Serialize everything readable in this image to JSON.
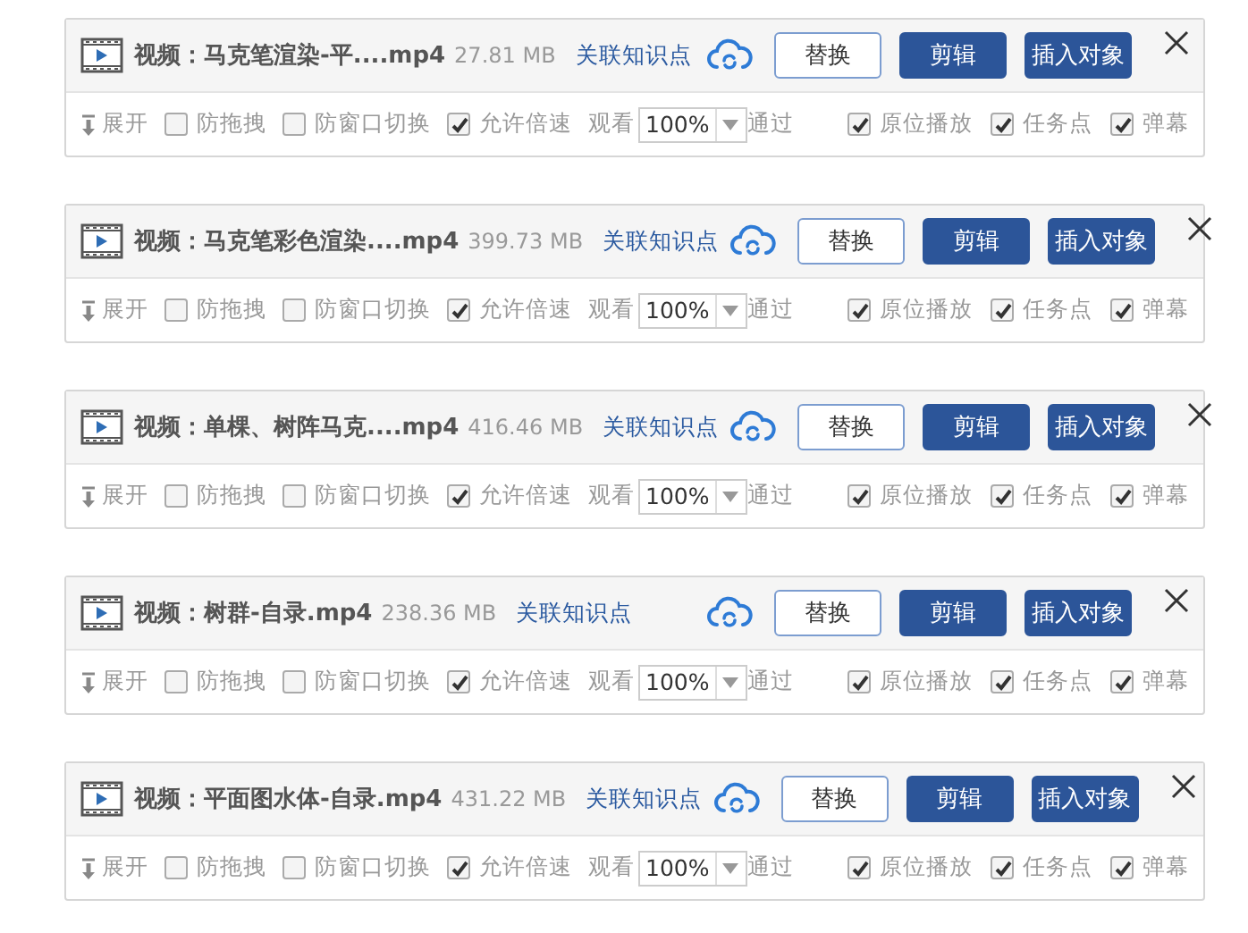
{
  "cards": [
    {
      "title": "视频：马克笔渲染-平....mp4",
      "size": "27.81 MB",
      "link": "关联知识点",
      "buttons": [
        {
          "label": "替换",
          "kind": "outline"
        },
        {
          "label": "剪辑",
          "kind": "primary"
        },
        {
          "label": "插入对象",
          "kind": "primary"
        }
      ],
      "expand": "展开",
      "options": [
        {
          "label": "防拖拽",
          "checked": false
        },
        {
          "label": "防窗口切换",
          "checked": false
        },
        {
          "label": "允许倍速",
          "checked": true
        }
      ],
      "watch_label": "观看",
      "speed": "100%",
      "pass_label": "通过",
      "right_options": [
        {
          "label": "原位播放",
          "checked": true
        },
        {
          "label": "任务点",
          "checked": true
        },
        {
          "label": "弹幕",
          "checked": true
        }
      ]
    },
    {
      "title": "视频：马克笔彩色渲染....mp4",
      "size": "399.73 MB",
      "link": "关联知识点",
      "buttons": [
        {
          "label": "替换",
          "kind": "outline"
        },
        {
          "label": "剪辑",
          "kind": "primary"
        },
        {
          "label": "插入对象",
          "kind": "primary"
        }
      ],
      "expand": "展开",
      "options": [
        {
          "label": "防拖拽",
          "checked": false
        },
        {
          "label": "防窗口切换",
          "checked": false
        },
        {
          "label": "允许倍速",
          "checked": true
        }
      ],
      "watch_label": "观看",
      "speed": "100%",
      "pass_label": "通过",
      "right_options": [
        {
          "label": "原位播放",
          "checked": true
        },
        {
          "label": "任务点",
          "checked": true
        },
        {
          "label": "弹幕",
          "checked": true
        }
      ]
    },
    {
      "title": "视频：单棵、树阵马克....mp4",
      "size": "416.46 MB",
      "link": "关联知识点",
      "buttons": [
        {
          "label": "替换",
          "kind": "outline"
        },
        {
          "label": "剪辑",
          "kind": "primary"
        },
        {
          "label": "插入对象",
          "kind": "primary"
        }
      ],
      "expand": "展开",
      "options": [
        {
          "label": "防拖拽",
          "checked": false
        },
        {
          "label": "防窗口切换",
          "checked": false
        },
        {
          "label": "允许倍速",
          "checked": true
        }
      ],
      "watch_label": "观看",
      "speed": "100%",
      "pass_label": "通过",
      "right_options": [
        {
          "label": "原位播放",
          "checked": true
        },
        {
          "label": "任务点",
          "checked": true
        },
        {
          "label": "弹幕",
          "checked": true
        }
      ]
    },
    {
      "title": "视频：树群-自录.mp4",
      "size": "238.36 MB",
      "link": "关联知识点",
      "buttons": [
        {
          "label": "替换",
          "kind": "outline"
        },
        {
          "label": "剪辑",
          "kind": "primary"
        },
        {
          "label": "插入对象",
          "kind": "primary"
        }
      ],
      "expand": "展开",
      "options": [
        {
          "label": "防拖拽",
          "checked": false
        },
        {
          "label": "防窗口切换",
          "checked": false
        },
        {
          "label": "允许倍速",
          "checked": true
        }
      ],
      "watch_label": "观看",
      "speed": "100%",
      "pass_label": "通过",
      "right_options": [
        {
          "label": "原位播放",
          "checked": true
        },
        {
          "label": "任务点",
          "checked": true
        },
        {
          "label": "弹幕",
          "checked": true
        }
      ]
    },
    {
      "title": "视频：平面图水体-自录.mp4",
      "size": "431.22 MB",
      "link": "关联知识点",
      "buttons": [
        {
          "label": "替换",
          "kind": "outline"
        },
        {
          "label": "剪辑",
          "kind": "primary"
        },
        {
          "label": "插入对象",
          "kind": "primary"
        }
      ],
      "expand": "展开",
      "options": [
        {
          "label": "防拖拽",
          "checked": false
        },
        {
          "label": "防窗口切换",
          "checked": false
        },
        {
          "label": "允许倍速",
          "checked": true
        }
      ],
      "watch_label": "观看",
      "speed": "100%",
      "pass_label": "通过",
      "right_options": [
        {
          "label": "原位播放",
          "checked": true
        },
        {
          "label": "任务点",
          "checked": true
        },
        {
          "label": "弹幕",
          "checked": true
        }
      ]
    }
  ]
}
